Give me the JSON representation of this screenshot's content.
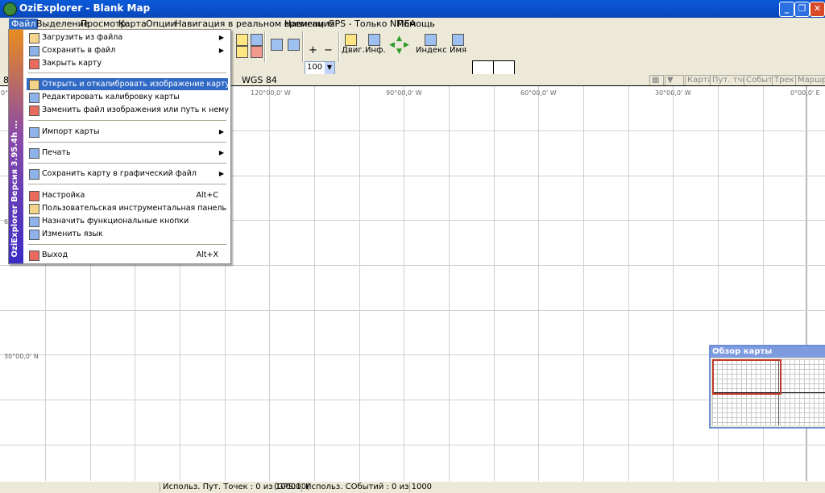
{
  "window": {
    "title": "OziExplorer - Blank Map"
  },
  "menubar": [
    "Файл",
    "Выделение",
    "Просмотр",
    "Карта",
    "Опции",
    "Навигация в реальном времени",
    "Навигация",
    "GPS - Только NMEA",
    "Помощь"
  ],
  "toolbar": {
    "zoom_value": "100",
    "labels": {
      "move": "Двиг.",
      "info": "Инф.",
      "index": "Индекс",
      "name": "Имя"
    }
  },
  "infobar": {
    "left_stub": "8",
    "datum": "WGS 84",
    "buttons": [
      "Карта",
      "Пут. тчк.",
      "Событ",
      "Трек",
      "Маршр"
    ]
  },
  "map": {
    "lon_labels": [
      "0°",
      "120°00,0' W",
      "90°00,0' W",
      "60°00,0' W",
      "30°00,0' W",
      "0°00,0' E"
    ],
    "lat_labels": [
      "60°",
      "30°00,0' N"
    ]
  },
  "overview": {
    "title": "Обзор карты"
  },
  "status": {
    "waypoints": "Использ. Пут. Точек : 0 из 10000",
    "gps": "(GPS:10(",
    "events": "Использ. СОбытий : 0 из 1000"
  },
  "file_menu": {
    "banner": "OziExplorer  Версия 3.95.4h ...",
    "items": [
      {
        "label": "Загрузить из файла",
        "arrow": "▶"
      },
      {
        "label": "Сохранить в файл",
        "arrow": "▶"
      },
      {
        "label": "Закрыть карту"
      },
      {
        "label": "Открыть и откалибровать изображение карту"
      },
      {
        "label": "Редактировать калибровку карты"
      },
      {
        "label": "Заменить файл изображения или путь к нему"
      },
      {
        "label": "Импорт карты",
        "arrow": "▶"
      },
      {
        "label": "Печать",
        "arrow": "▶"
      },
      {
        "label": "Сохранить карту в графический файл",
        "arrow": "▶"
      },
      {
        "label": "Настройка",
        "shortcut": "Alt+C"
      },
      {
        "label": "Пользовательская инструментальная панель"
      },
      {
        "label": "Назначить функциональные кнопки"
      },
      {
        "label": "Изменить язык"
      },
      {
        "label": "Выход",
        "shortcut": "Alt+X"
      }
    ]
  }
}
